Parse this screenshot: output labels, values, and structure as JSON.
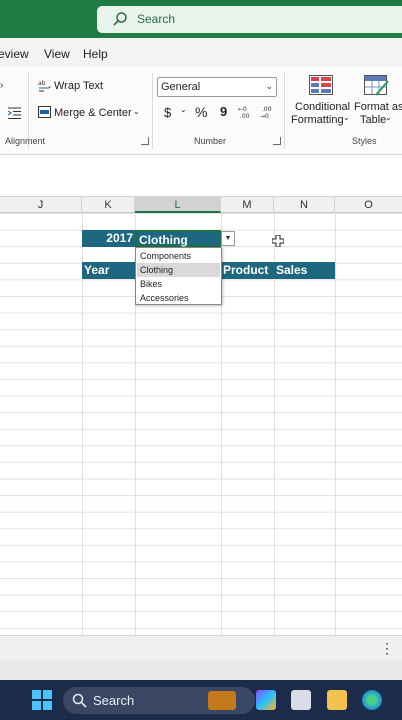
{
  "titlebar": {
    "search_label": "Search"
  },
  "menu": {
    "items": [
      "eview",
      "View",
      "Help"
    ]
  },
  "ribbon": {
    "alignment": {
      "wrap_text": "Wrap Text",
      "merge_center": "Merge & Center",
      "group_label": "Alignment"
    },
    "number": {
      "format_value": "General",
      "currency": "$",
      "percent": "%",
      "comma": "9",
      "group_label": "Number"
    },
    "styles": {
      "conditional_line1": "Conditional",
      "conditional_line2": "Formatting",
      "format_as_line1": "Format as",
      "format_as_line2": "Table",
      "group_label": "Styles"
    }
  },
  "grid": {
    "columns": [
      "J",
      "K",
      "L",
      "M",
      "N",
      "O"
    ],
    "selected_column": "L",
    "year_value": "2017",
    "category_value": "Clothing",
    "headers": {
      "year": "Year",
      "product": "Product",
      "sales": "Sales"
    }
  },
  "dropdown": {
    "options": [
      "Components",
      "Clothing",
      "Bikes",
      "Accessories"
    ],
    "selected": "Clothing"
  },
  "taskbar": {
    "search_label": "Search"
  },
  "colors": {
    "accent_green": "#1e7145",
    "header_fill": "#1d6781",
    "titlebar": "#1f7a43"
  }
}
